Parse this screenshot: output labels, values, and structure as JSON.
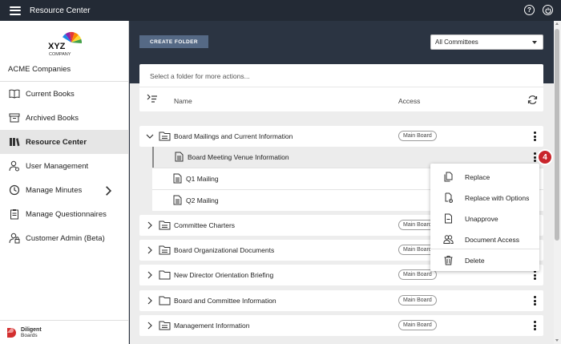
{
  "header": {
    "title": "Resource Center",
    "help_icon": "question-circle-icon",
    "user_icon": "power-user-icon"
  },
  "sidebar": {
    "logo_text": "XYZ",
    "logo_subtext": "COMPANY",
    "company": "ACME Companies",
    "items": [
      {
        "label": "Current Books",
        "icon": "book-open-icon"
      },
      {
        "label": "Archived Books",
        "icon": "archive-box-icon"
      },
      {
        "label": "Resource Center",
        "icon": "books-icon",
        "active": true
      },
      {
        "label": "User Management",
        "icon": "user-gear-icon"
      },
      {
        "label": "Manage Minutes",
        "icon": "clock-icon",
        "has_submenu": true
      },
      {
        "label": "Manage Questionnaires",
        "icon": "clipboard-icon"
      },
      {
        "label": "Customer Admin (Beta)",
        "icon": "user-admin-icon"
      }
    ],
    "footer_brand": "Diligent",
    "footer_sub": "Boards"
  },
  "toolbar": {
    "create_folder": "CREATE FOLDER",
    "committee_value": "All Committees"
  },
  "panel": {
    "hint": "Select a folder for more actions...",
    "col_name": "Name",
    "col_access": "Access"
  },
  "folders": [
    {
      "name": "Board Mailings and Current Information",
      "access": "Main Board",
      "expanded": true,
      "children": [
        "Board Meeting Venue Information",
        "Q1 Mailing",
        "Q2 Mailing"
      ]
    },
    {
      "name": "Committee Charters",
      "access": "Main Board"
    },
    {
      "name": "Board Organizational Documents",
      "access": "Main Board"
    },
    {
      "name": "New Director Orientation Briefing",
      "access": "Main Board"
    },
    {
      "name": "Board and Committee Information",
      "access": "Main Board"
    },
    {
      "name": "Management Information",
      "access": "Main Board"
    }
  ],
  "step_number": "4",
  "context_menu": {
    "items": [
      {
        "label": "Replace",
        "icon": "replace-doc-icon"
      },
      {
        "label": "Replace with Options",
        "icon": "replace-options-icon"
      },
      {
        "label": "Unapprove",
        "icon": "unapprove-doc-icon"
      },
      {
        "label": "Document Access",
        "icon": "users-icon"
      },
      {
        "label": "Delete",
        "icon": "trash-icon"
      }
    ]
  },
  "colors": {
    "topbar": "#232a35",
    "create_button": "#556985",
    "step_badge": "#c9252c"
  }
}
